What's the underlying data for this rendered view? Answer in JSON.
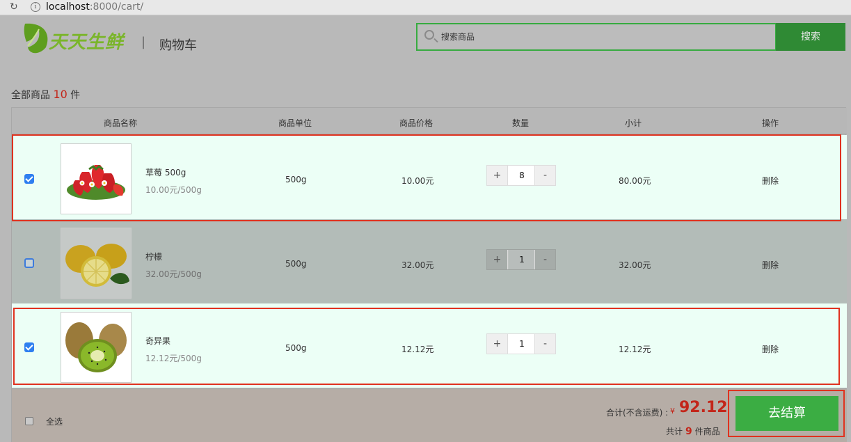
{
  "browser": {
    "url_host": "localhost",
    "url_rest": ":8000/cart/"
  },
  "header": {
    "logo_text": "天天生鲜",
    "divider": "|",
    "title": "购物车",
    "search_placeholder": "搜索商品",
    "search_button": "搜索"
  },
  "summary": {
    "prefix": "全部商品",
    "count": "10",
    "suffix": "件"
  },
  "table": {
    "headers": [
      "商品名称",
      "商品单位",
      "商品价格",
      "数量",
      "小计",
      "操作"
    ],
    "rows": [
      {
        "name": "草莓 500g",
        "unit_price": "10.00元/500g",
        "unit": "500g",
        "price": "10.00元",
        "qty": "8",
        "subtotal": "80.00元",
        "action": "删除",
        "checked": true,
        "image": "strawberry-image"
      },
      {
        "name": "柠檬",
        "unit_price": "32.00元/500g",
        "unit": "500g",
        "price": "32.00元",
        "qty": "1",
        "subtotal": "32.00元",
        "action": "删除",
        "checked": false,
        "image": "lemon-image"
      },
      {
        "name": "奇异果",
        "unit_price": "12.12元/500g",
        "unit": "500g",
        "price": "12.12元",
        "qty": "1",
        "subtotal": "12.12元",
        "action": "删除",
        "checked": true,
        "image": "kiwi-image"
      }
    ],
    "qty_plus": "+",
    "qty_minus": "-"
  },
  "footer": {
    "select_all": "全选",
    "total_label": "合计(不含运费) :",
    "currency": "¥",
    "total_value": "92.12",
    "items_prefix": "共计",
    "items_count": "9",
    "items_suffix": "件商品",
    "checkout": "去结算"
  },
  "colors": {
    "accent_red": "#c3261a",
    "brand_green": "#3bad43",
    "outline_red": "#e0321f"
  }
}
